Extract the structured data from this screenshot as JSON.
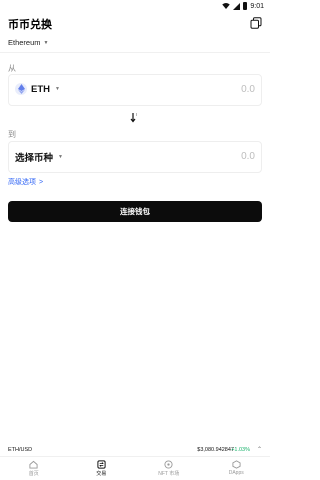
{
  "status_bar": {
    "time": "9:01"
  },
  "header": {
    "title": "币币兑换"
  },
  "network": {
    "selected": "Ethereum"
  },
  "from": {
    "label": "从",
    "token": "ETH",
    "amount_placeholder": "0.0"
  },
  "to": {
    "label": "到",
    "token": "选择币种",
    "amount_placeholder": "0.0"
  },
  "advanced": {
    "label": "高级选项",
    "chevron": ">"
  },
  "connect_button": {
    "label": "连接钱包"
  },
  "ticker": {
    "pair": "ETH/USD",
    "price": "$3,080.942847",
    "change": "+1.03%"
  },
  "tabbar": {
    "tabs": [
      {
        "label": "首页",
        "icon": "home-icon",
        "active": false
      },
      {
        "label": "交易",
        "icon": "trade-icon",
        "active": true
      },
      {
        "label": "NFT 市场",
        "icon": "nft-market-icon",
        "active": false
      },
      {
        "label": "DApps",
        "icon": "dapps-icon",
        "active": false
      }
    ]
  },
  "colors": {
    "accent_link": "#2f64f5",
    "button_bg": "#0c0c0c",
    "positive": "#18b26b"
  }
}
